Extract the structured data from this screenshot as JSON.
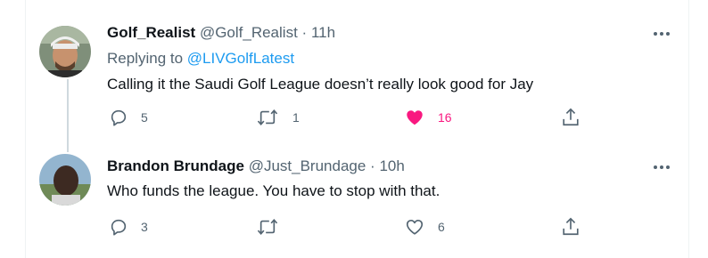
{
  "tweets": [
    {
      "name": "Golf_Realist",
      "handle": "@Golf_Realist",
      "separator": "·",
      "time": "11h",
      "replying_prefix": "Replying to ",
      "replying_to": "@LIVGolfLatest",
      "text": "Calling it the Saudi Golf League doesn’t really look good for Jay",
      "replies": "5",
      "retweets": "1",
      "likes": "16",
      "liked": true
    },
    {
      "name": "Brandon Brundage",
      "handle": "@Just_Brundage",
      "separator": "·",
      "time": "10h",
      "text": "Who funds the league. You have to stop with that.",
      "replies": "3",
      "retweets": "",
      "likes": "6",
      "liked": false
    }
  ],
  "colors": {
    "text": "#0f1419",
    "secondary": "#536471",
    "link": "#1d9bf0",
    "like": "#f91880",
    "thread_line": "#cfd9de"
  },
  "icons": [
    "avatar",
    "more-icon",
    "reply-icon",
    "retweet-icon",
    "like-icon",
    "share-icon"
  ]
}
